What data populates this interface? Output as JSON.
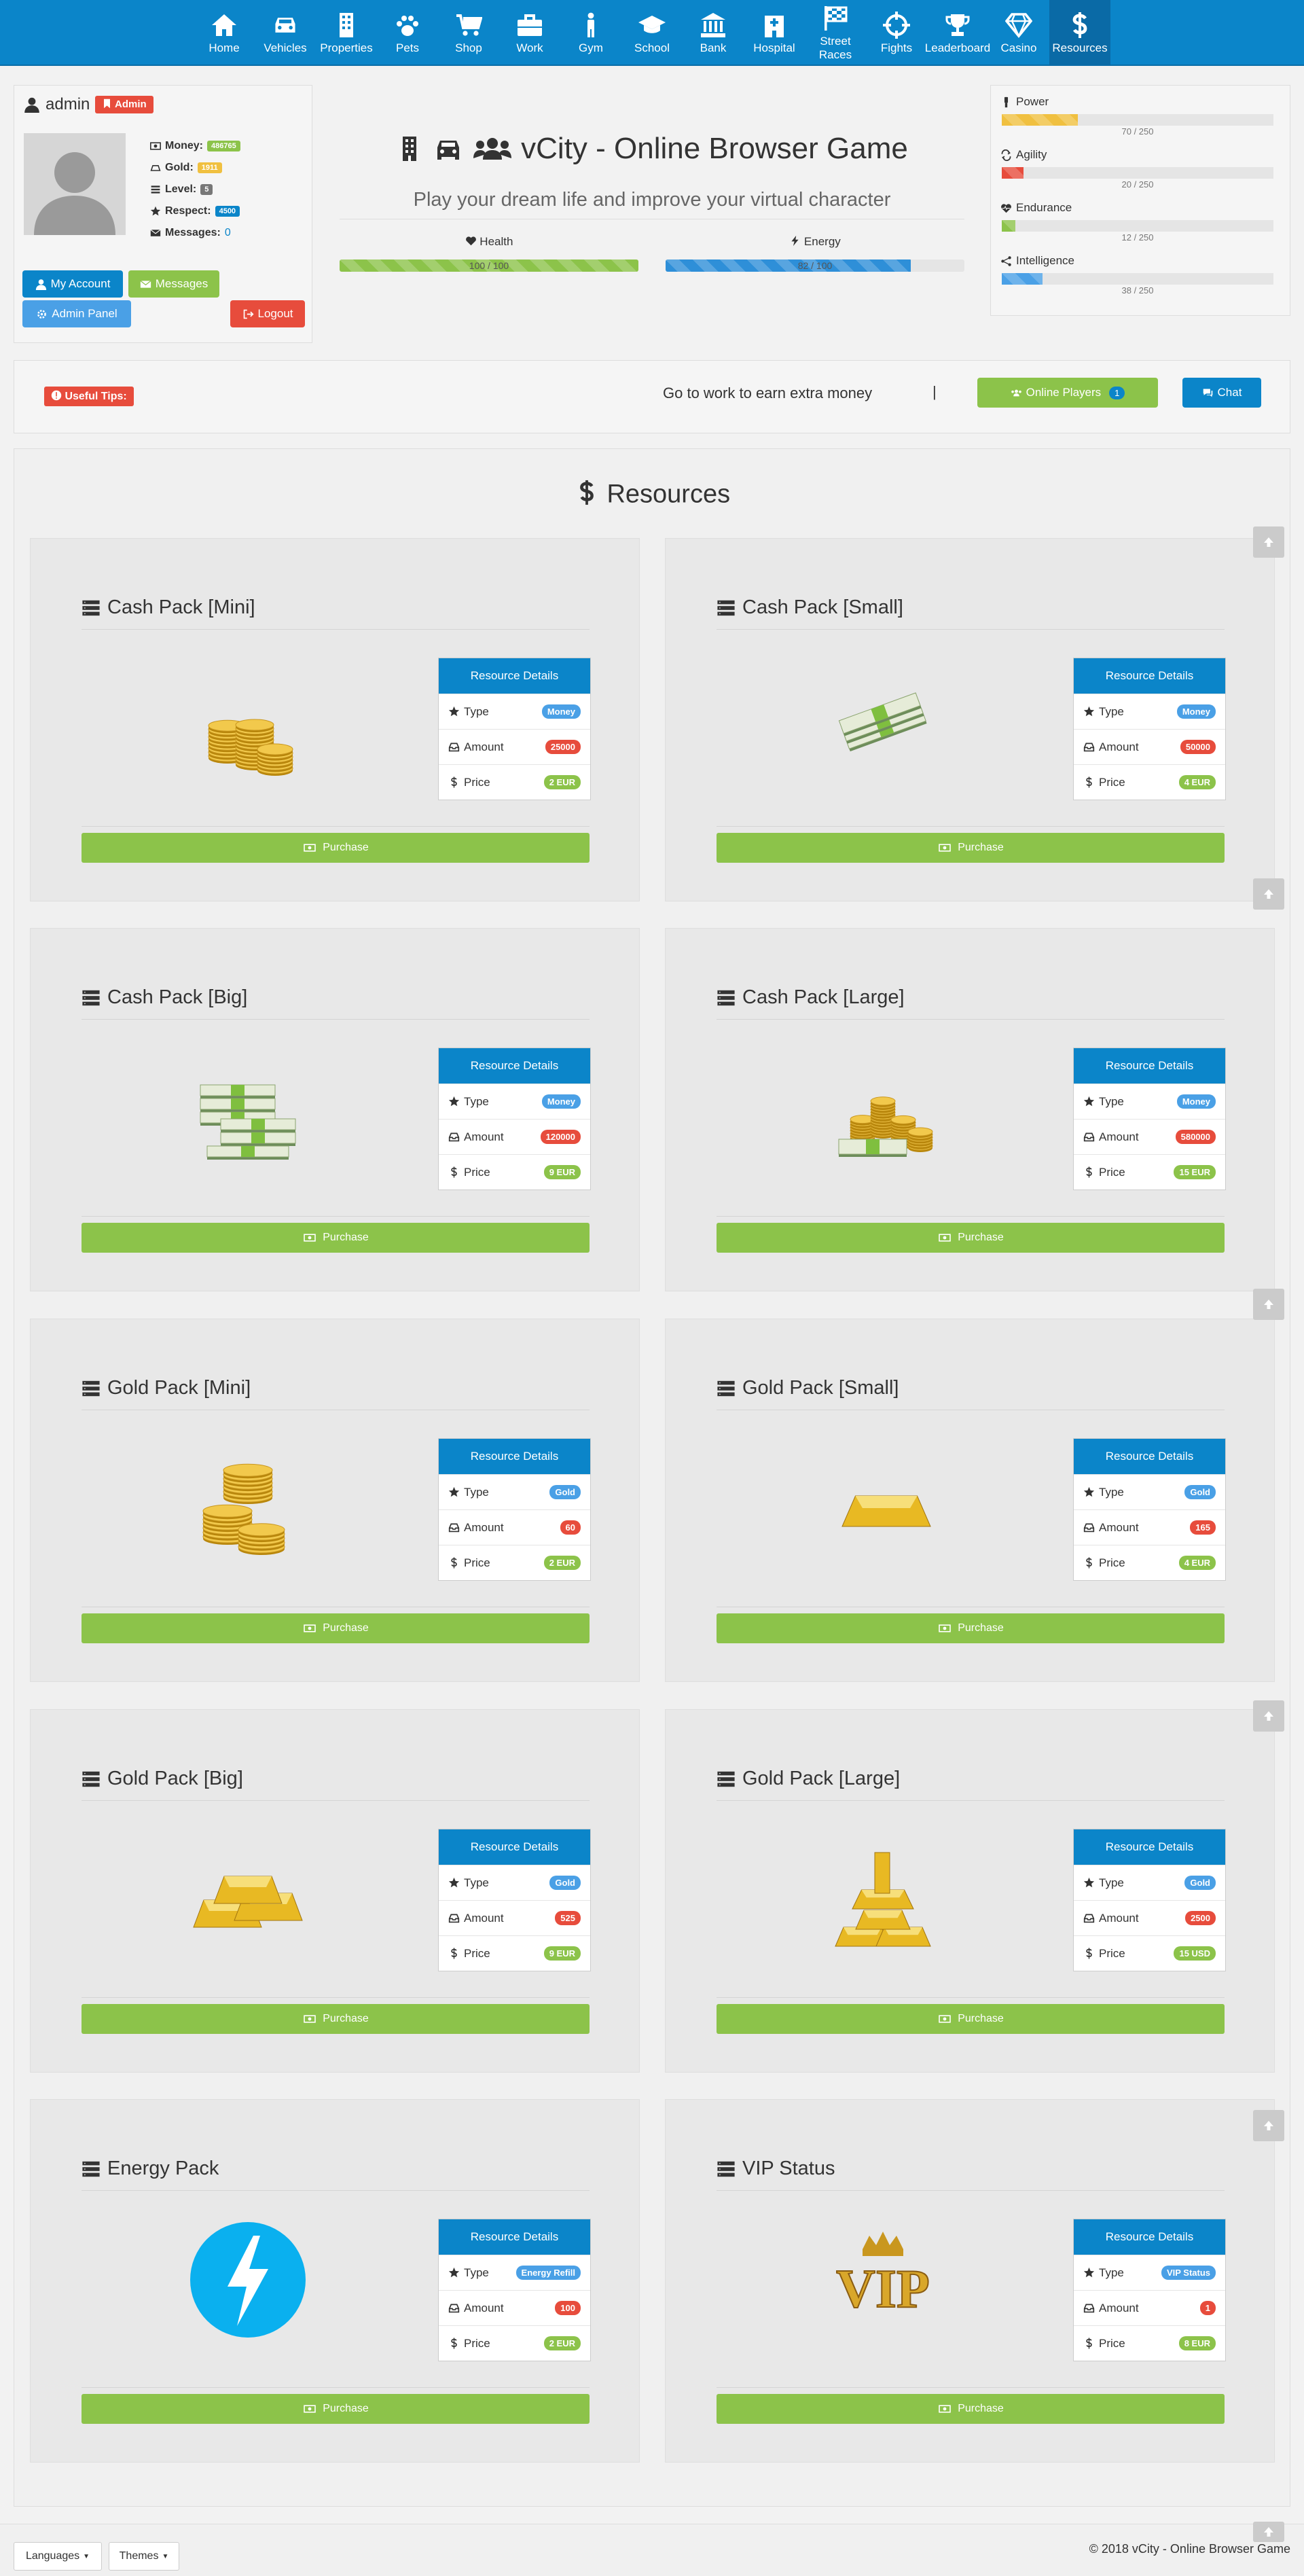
{
  "nav": [
    {
      "label": "Home",
      "icon": "home-icon"
    },
    {
      "label": "Vehicles",
      "icon": "car-icon"
    },
    {
      "label": "Properties",
      "icon": "building-icon"
    },
    {
      "label": "Pets",
      "icon": "paw-icon"
    },
    {
      "label": "Shop",
      "icon": "cart-icon"
    },
    {
      "label": "Work",
      "icon": "briefcase-icon"
    },
    {
      "label": "Gym",
      "icon": "person-icon"
    },
    {
      "label": "School",
      "icon": "graduation-cap-icon"
    },
    {
      "label": "Bank",
      "icon": "bank-icon"
    },
    {
      "label": "Hospital",
      "icon": "hospital-icon"
    },
    {
      "label": "Street Races",
      "icon": "checkered-flag-icon"
    },
    {
      "label": "Fights",
      "icon": "crosshairs-icon"
    },
    {
      "label": "Leaderboard",
      "icon": "trophy-icon"
    },
    {
      "label": "Casino",
      "icon": "diamond-icon"
    },
    {
      "label": "Resources",
      "icon": "dollar-icon"
    }
  ],
  "user": {
    "name": "admin",
    "role_badge": "Admin",
    "money_label": "Money:",
    "money": "486765",
    "gold_label": "Gold:",
    "gold": "1911",
    "level_label": "Level:",
    "level": "5",
    "respect_label": "Respect:",
    "respect": "4500",
    "messages_label": "Messages:",
    "messages": "0",
    "my_account": "My Account",
    "messages_btn": "Messages",
    "admin_panel": "Admin Panel",
    "logout": "Logout"
  },
  "header": {
    "title": "vCity - Online Browser Game",
    "subtitle": "Play your dream life and improve your virtual character",
    "health_label": "Health",
    "health_text": "100 / 100",
    "health_value": 1.0,
    "energy_label": "Energy",
    "energy_text": "82 / 100",
    "energy_value": 0.82
  },
  "attributes": [
    {
      "name": "Power",
      "text": "70 / 250",
      "value": 0.28,
      "color": "#f0c040",
      "icon": "fist-icon"
    },
    {
      "name": "Agility",
      "text": "20 / 250",
      "value": 0.08,
      "color": "#e74c3c",
      "icon": "arrows-icon"
    },
    {
      "name": "Endurance",
      "text": "12 / 250",
      "value": 0.05,
      "color": "#8cc34a",
      "icon": "heartbeat-icon"
    },
    {
      "name": "Intelligence",
      "text": "38 / 250",
      "value": 0.15,
      "color": "#4aa0e6",
      "icon": "network-icon"
    }
  ],
  "tips": {
    "badge": "Useful Tips:",
    "text": "Go to work to earn extra money",
    "separator": "|",
    "online_players": "Online Players",
    "online_count": "1",
    "chat": "Chat"
  },
  "resources": {
    "title": "Resources",
    "details_header": "Resource Details",
    "type_label": "Type",
    "amount_label": "Amount",
    "price_label": "Price",
    "purchase_label": "Purchase",
    "items": [
      {
        "name": "Cash Pack [Mini]",
        "type": "Money",
        "amount": "25000",
        "price": "2 EUR",
        "image": "gold-coins-stack"
      },
      {
        "name": "Cash Pack [Small]",
        "type": "Money",
        "amount": "50000",
        "price": "4 EUR",
        "image": "cash-bundle"
      },
      {
        "name": "Cash Pack [Big]",
        "type": "Money",
        "amount": "120000",
        "price": "9 EUR",
        "image": "cash-stacks"
      },
      {
        "name": "Cash Pack [Large]",
        "type": "Money",
        "amount": "580000",
        "price": "15 EUR",
        "image": "coins-and-cash"
      },
      {
        "name": "Gold Pack [Mini]",
        "type": "Gold",
        "amount": "60",
        "price": "2 EUR",
        "image": "gold-coin-pile"
      },
      {
        "name": "Gold Pack [Small]",
        "type": "Gold",
        "amount": "165",
        "price": "4 EUR",
        "image": "gold-bar"
      },
      {
        "name": "Gold Pack [Big]",
        "type": "Gold",
        "amount": "525",
        "price": "9 EUR",
        "image": "gold-bars"
      },
      {
        "name": "Gold Pack [Large]",
        "type": "Gold",
        "amount": "2500",
        "price": "15 USD",
        "image": "gold-bar-pile"
      },
      {
        "name": "Energy Pack",
        "type": "Energy Refill",
        "amount": "100",
        "price": "2 EUR",
        "image": "lightning-circle"
      },
      {
        "name": "VIP Status",
        "type": "VIP Status",
        "amount": "1",
        "price": "8 EUR",
        "image": "vip-crown"
      }
    ]
  },
  "footer": {
    "languages": "Languages",
    "themes": "Themes",
    "copyright": "© 2018 vCity - Online Browser Game"
  }
}
